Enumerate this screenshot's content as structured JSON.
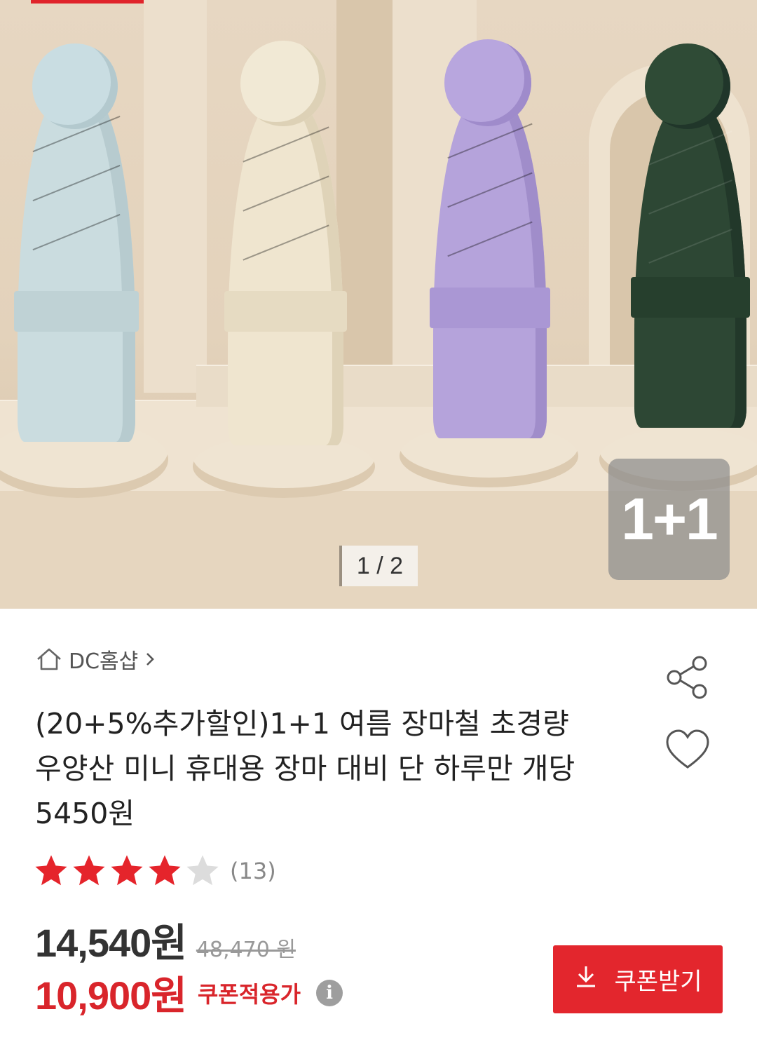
{
  "hero": {
    "badge": "1+1",
    "pager": "1 / 2",
    "colors": {
      "blue": "#cfe0e3",
      "cream": "#f1e8d3",
      "lavender": "#b8a6dd",
      "green": "#2e4a36"
    }
  },
  "store": {
    "name": "DC홈샵",
    "icon": "home-icon"
  },
  "product": {
    "title": "(20+5%추가할인)1+1 여름 장마철 초경량 우양산 미니 휴대용 장마 대비 단 하루만 개당 5450원",
    "rating": 4,
    "rating_max": 5,
    "review_count": "(13)"
  },
  "price": {
    "current": "14,540원",
    "original": "48,470 원",
    "coupon_price": "10,900원",
    "coupon_label": "쿠폰적용가",
    "info_icon": "i"
  },
  "actions": {
    "coupon_button": "쿠폰받기",
    "share_icon": "share-icon",
    "heart_icon": "heart-icon"
  },
  "accent": "#e0242b"
}
